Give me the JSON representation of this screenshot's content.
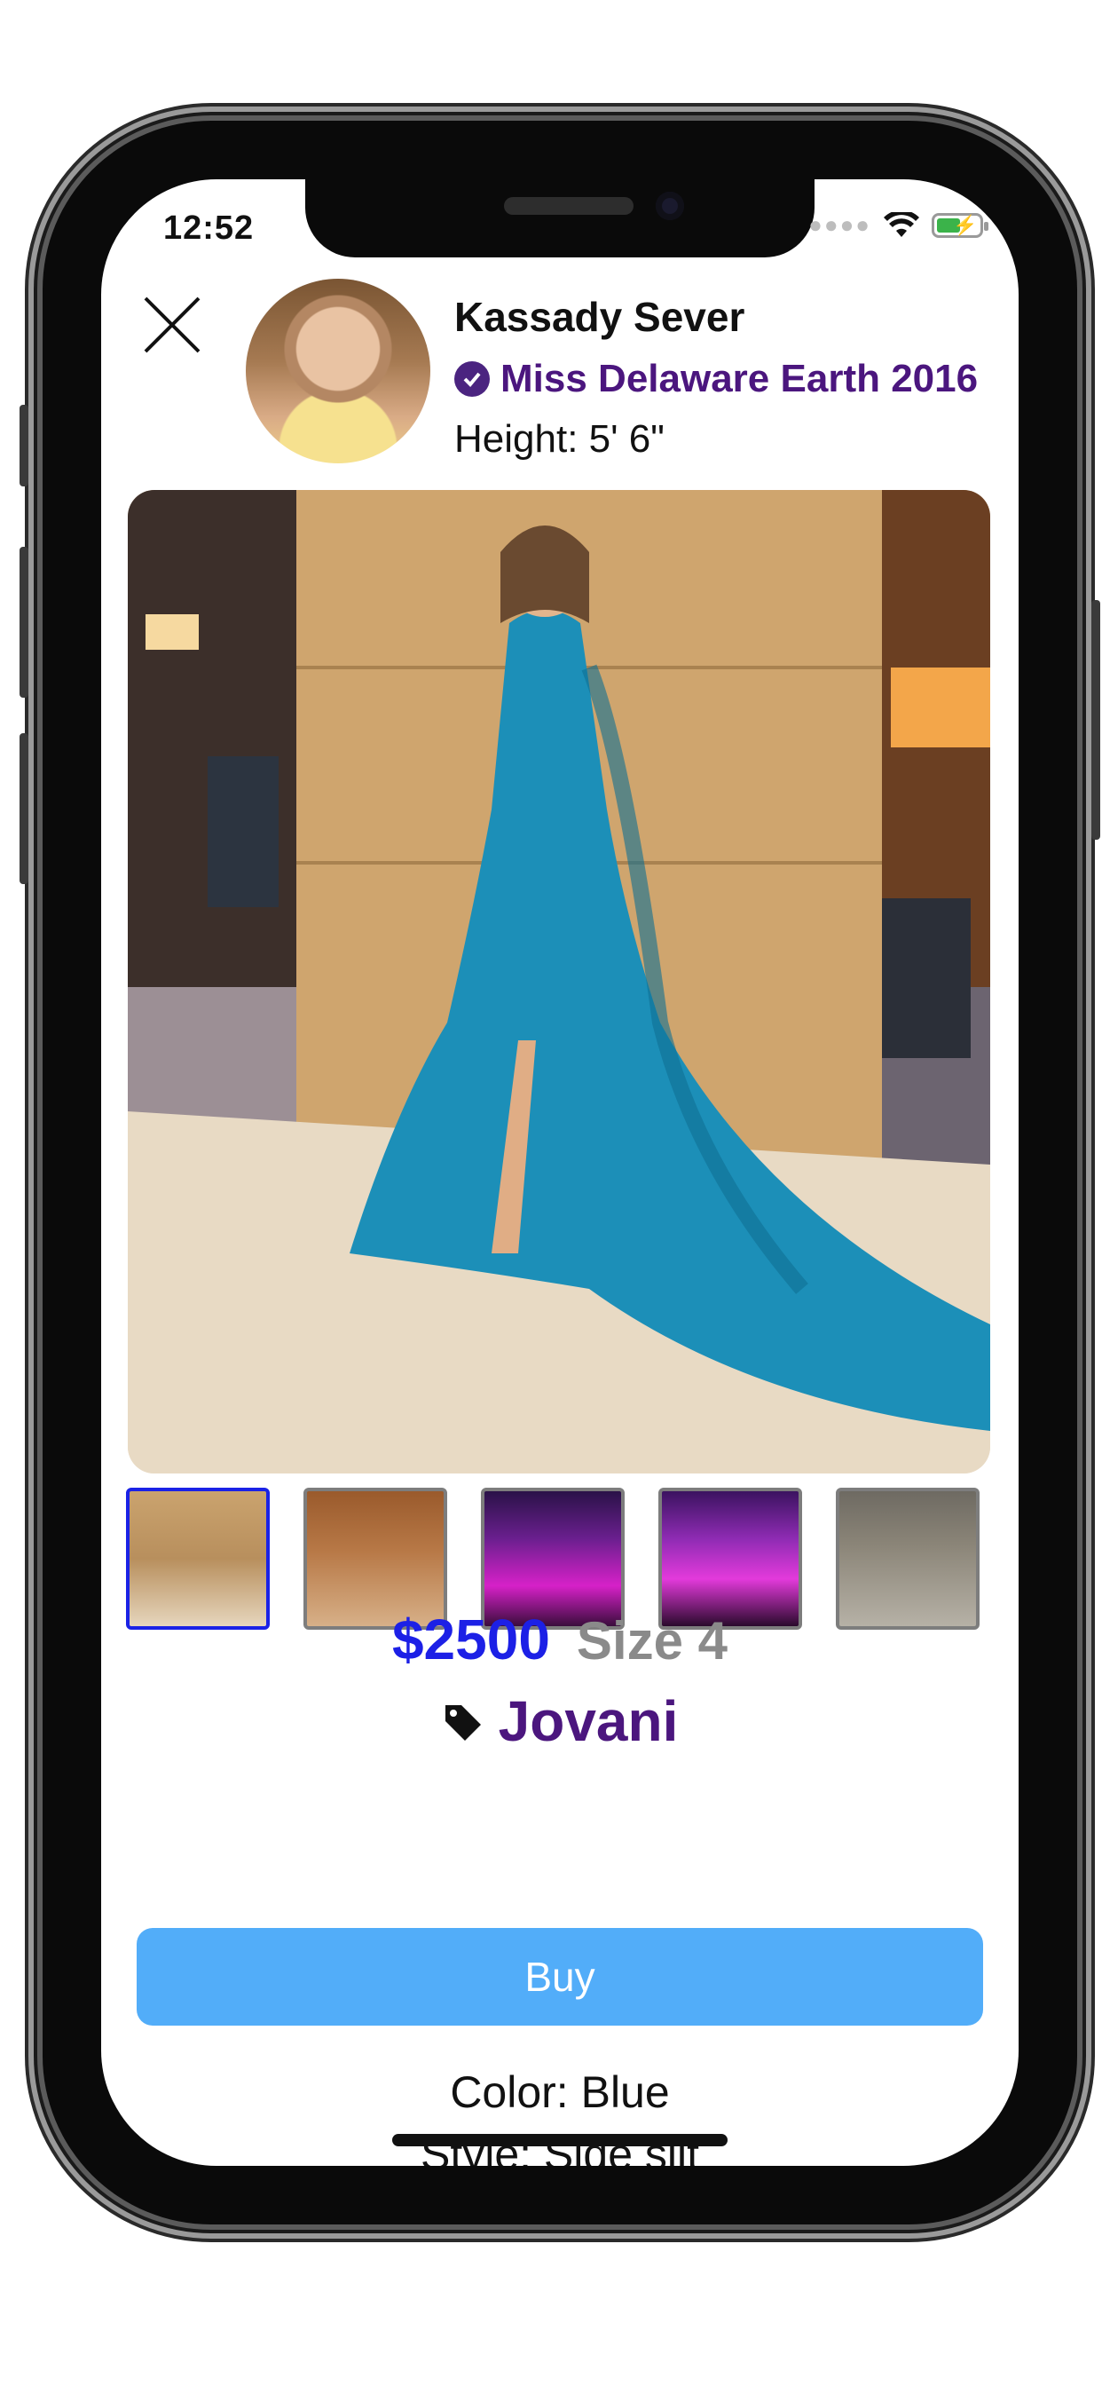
{
  "status_bar": {
    "time": "12:52"
  },
  "profile": {
    "name": "Kassady Sever",
    "title": "Miss Delaware Earth 2016",
    "height": "Height: 5' 6\""
  },
  "gallery": {
    "thumbnail_count": 5,
    "selected_index": 0
  },
  "listing": {
    "price": "$2500",
    "size": "Size 4",
    "brand": "Jovani",
    "buy_label": "Buy",
    "color": "Color: Blue",
    "style": "Style: Side slit"
  },
  "colors": {
    "accent_purple": "#4b167e",
    "price_blue": "#1c20e6",
    "buy_button": "#52adf9",
    "selected_thumb_border": "#1a22e6"
  }
}
